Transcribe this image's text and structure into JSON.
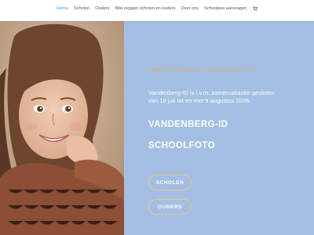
{
  "nav": {
    "items": [
      {
        "label": "Home",
        "active": true
      },
      {
        "label": "Scholen",
        "active": false
      },
      {
        "label": "Ouders",
        "active": false
      },
      {
        "label": "Wat zeggen scholen en ouders",
        "active": false
      },
      {
        "label": "Over ons",
        "active": false
      },
      {
        "label": "Schoolpas aanvragen",
        "active": false
      }
    ],
    "cart_icon": "shopping-cart-icon",
    "active_color": "#2ea3f2"
  },
  "hero": {
    "eyebrow": "OMDAT FOTOGRAFIE ONZE PASSIE IS",
    "notice_line1": "Vandenberg-ID is i.v.m. zomervakantie gesloten",
    "notice_line2": "van 18 juli tot en met 9 augustus 2026.",
    "title_line1": "VANDENBERG-ID",
    "title_line2": "SCHOOLFOTO",
    "panel_color": "#a4bfe3",
    "accent_color": "#d8b36c"
  },
  "buttons": {
    "scholen": "SCHOLEN",
    "ouders": "OUDERS"
  }
}
